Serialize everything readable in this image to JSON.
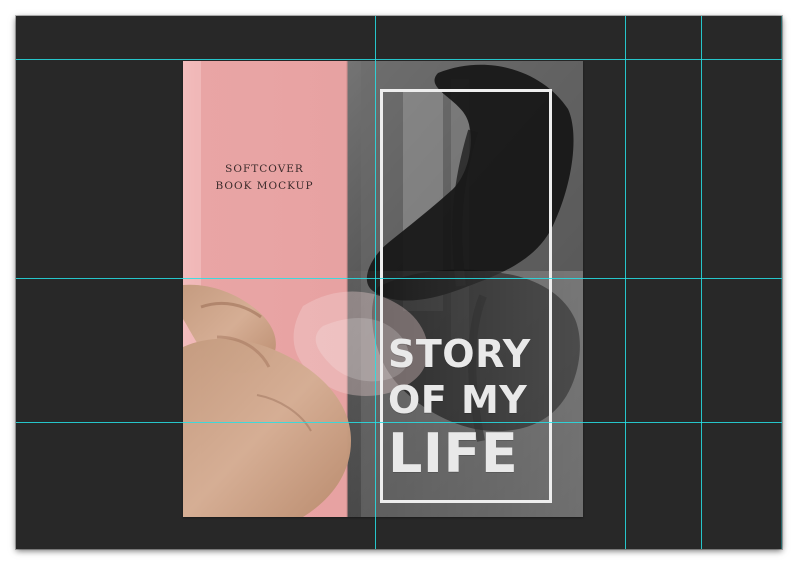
{
  "book": {
    "spine_text_line1": "SOFTCOVER",
    "spine_text_line2": "BOOK MOCKUP",
    "title_line1": "STORY",
    "title_line2": "OF MY",
    "title_line3": "LIFE"
  },
  "colors": {
    "canvas_bg": "#282828",
    "guide": "#26e0e6",
    "pink_cover": "#e8a8a8",
    "title_text": "#e9e9e9"
  },
  "guides": {
    "vertical_count": 4,
    "horizontal_count": 3
  }
}
